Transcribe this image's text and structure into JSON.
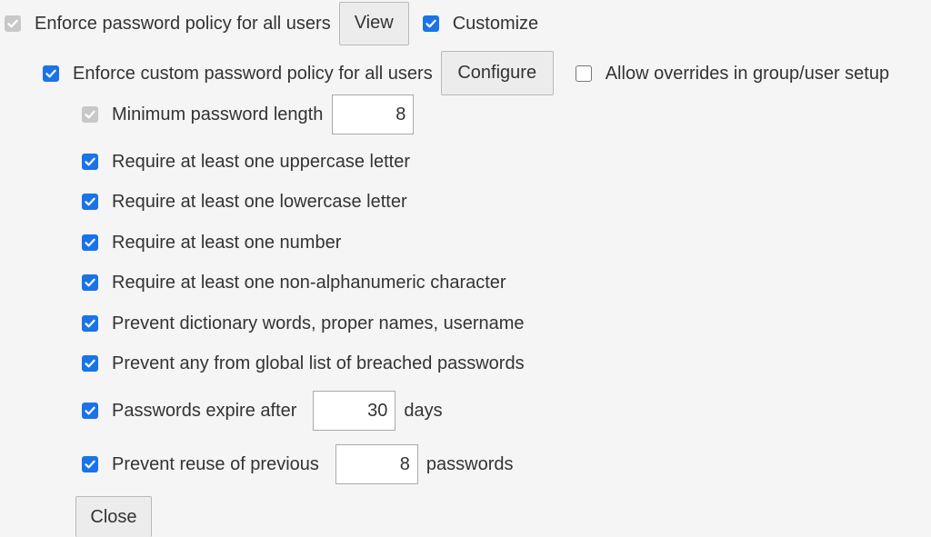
{
  "enforce_policy": {
    "label": "Enforce password policy for all users",
    "checked": true,
    "disabled": true,
    "view_button": "View",
    "customize_label": "Customize",
    "customize_checked": true
  },
  "custom_policy": {
    "label": "Enforce custom password policy for all users",
    "checked": true,
    "configure_button": "Configure",
    "allow_overrides_label": "Allow overrides in group/user setup",
    "allow_overrides_checked": false
  },
  "rules": {
    "min_length": {
      "label": "Minimum password length",
      "value": "8",
      "checked": true,
      "disabled": true
    },
    "uppercase": {
      "label": "Require at least one uppercase letter",
      "checked": true
    },
    "lowercase": {
      "label": "Require at least one lowercase letter",
      "checked": true
    },
    "number": {
      "label": "Require at least one number",
      "checked": true
    },
    "non_alnum": {
      "label": "Require at least one non-alphanumeric character",
      "checked": true
    },
    "dictionary": {
      "label": "Prevent dictionary words, proper names, username",
      "checked": true
    },
    "breached": {
      "label": "Prevent any from global list of breached passwords",
      "checked": true
    },
    "expire": {
      "label": "Passwords expire after",
      "value": "30",
      "unit": "days",
      "checked": true
    },
    "reuse": {
      "label": "Prevent reuse of previous",
      "value": "8",
      "unit": "passwords",
      "checked": true
    }
  },
  "close_button": "Close",
  "colors": {
    "accent": "#1a73e8",
    "disabled_check": "#c8c8c8",
    "background": "#f5f5f5",
    "text": "#333333"
  }
}
